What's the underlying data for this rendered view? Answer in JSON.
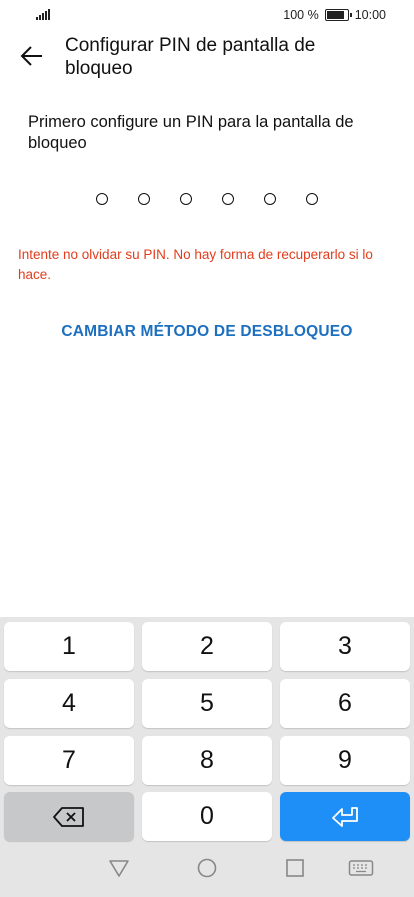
{
  "status_bar": {
    "battery_text": "100 %",
    "time": "10:00"
  },
  "header": {
    "title": "Configurar PIN de pantalla de bloqueo"
  },
  "prompt": "Primero configure un PIN para la pantalla de bloqueo",
  "warning": "Intente no olvidar su PIN. No hay forma de recuperarlo si lo hace.",
  "change_method": "CAMBIAR MÉTODO DE DESBLOQUEO",
  "keypad": {
    "k1": "1",
    "k2": "2",
    "k3": "3",
    "k4": "4",
    "k5": "5",
    "k6": "6",
    "k7": "7",
    "k8": "8",
    "k9": "9",
    "k0": "0"
  },
  "colors": {
    "warning": "#e23c1c",
    "link": "#1d6fbf",
    "enter_key": "#1e8ff7"
  },
  "icons": [
    "back-arrow-icon",
    "signal-icon",
    "battery-icon",
    "backspace-icon",
    "enter-icon",
    "nav-back-icon",
    "nav-home-icon",
    "nav-recents-icon",
    "keyboard-icon"
  ]
}
